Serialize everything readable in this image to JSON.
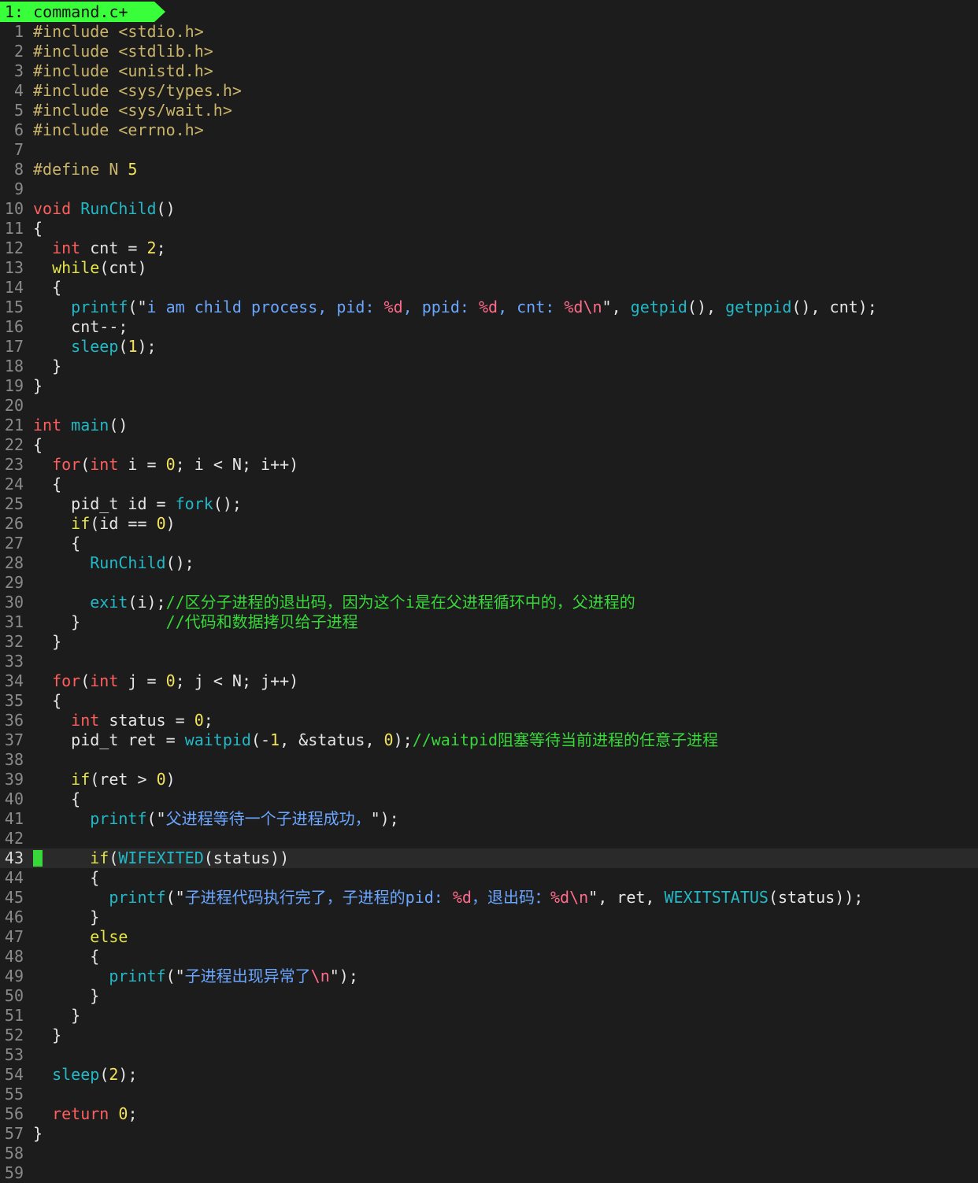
{
  "tab": {
    "label": "1: command.c+"
  },
  "cursor_line": "43",
  "lines": [
    {
      "n": "1",
      "segs": [
        [
          "p",
          "#include "
        ],
        [
          "p",
          "<stdio.h>"
        ]
      ]
    },
    {
      "n": "2",
      "segs": [
        [
          "p",
          "#include "
        ],
        [
          "p",
          "<stdlib.h>"
        ]
      ]
    },
    {
      "n": "3",
      "segs": [
        [
          "p",
          "#include "
        ],
        [
          "p",
          "<unistd.h>"
        ]
      ]
    },
    {
      "n": "4",
      "segs": [
        [
          "p",
          "#include "
        ],
        [
          "p",
          "<sys/types.h>"
        ]
      ]
    },
    {
      "n": "5",
      "segs": [
        [
          "p",
          "#include "
        ],
        [
          "p",
          "<sys/wait.h>"
        ]
      ]
    },
    {
      "n": "6",
      "segs": [
        [
          "p",
          "#include "
        ],
        [
          "p",
          "<errno.h>"
        ]
      ]
    },
    {
      "n": "7",
      "segs": []
    },
    {
      "n": "8",
      "segs": [
        [
          "p",
          "#define "
        ],
        [
          "p",
          "N "
        ],
        [
          "n",
          "5"
        ]
      ]
    },
    {
      "n": "9",
      "segs": []
    },
    {
      "n": "10",
      "segs": [
        [
          "k",
          "void "
        ],
        [
          "f",
          "RunChild"
        ],
        [
          "",
          "()"
        ]
      ]
    },
    {
      "n": "11",
      "segs": [
        [
          "",
          "{"
        ]
      ]
    },
    {
      "n": "12",
      "segs": [
        [
          "",
          "  "
        ],
        [
          "k",
          "int"
        ],
        [
          "",
          " cnt = "
        ],
        [
          "n",
          "2"
        ],
        [
          "",
          ";"
        ]
      ]
    },
    {
      "n": "13",
      "segs": [
        [
          "",
          "  "
        ],
        [
          "y",
          "while"
        ],
        [
          "",
          "(cnt)"
        ]
      ]
    },
    {
      "n": "14",
      "segs": [
        [
          "",
          "  {"
        ]
      ]
    },
    {
      "n": "15",
      "segs": [
        [
          "",
          "    "
        ],
        [
          "f",
          "printf"
        ],
        [
          "",
          "(\""
        ],
        [
          "s",
          "i am child process, pid: "
        ],
        [
          "e",
          "%d"
        ],
        [
          "s",
          ", ppid: "
        ],
        [
          "e",
          "%d"
        ],
        [
          "s",
          ", cnt: "
        ],
        [
          "e",
          "%d\\n"
        ],
        [
          "",
          "\", "
        ],
        [
          "f",
          "getpid"
        ],
        [
          "",
          "(), "
        ],
        [
          "f",
          "getppid"
        ],
        [
          "",
          "(), cnt);"
        ]
      ]
    },
    {
      "n": "16",
      "segs": [
        [
          "",
          "    cnt--;"
        ]
      ]
    },
    {
      "n": "17",
      "segs": [
        [
          "",
          "    "
        ],
        [
          "f",
          "sleep"
        ],
        [
          "",
          "("
        ],
        [
          "n",
          "1"
        ],
        [
          "",
          ");"
        ]
      ]
    },
    {
      "n": "18",
      "segs": [
        [
          "",
          "  }"
        ]
      ]
    },
    {
      "n": "19",
      "segs": [
        [
          "",
          "}"
        ]
      ]
    },
    {
      "n": "20",
      "segs": []
    },
    {
      "n": "21",
      "segs": [
        [
          "k",
          "int "
        ],
        [
          "f",
          "main"
        ],
        [
          "",
          "()"
        ]
      ]
    },
    {
      "n": "22",
      "segs": [
        [
          "",
          "{"
        ]
      ]
    },
    {
      "n": "23",
      "segs": [
        [
          "",
          "  "
        ],
        [
          "k",
          "for"
        ],
        [
          "",
          "("
        ],
        [
          "k",
          "int"
        ],
        [
          "",
          " i = "
        ],
        [
          "n",
          "0"
        ],
        [
          "",
          "; i < N; i++)"
        ]
      ]
    },
    {
      "n": "24",
      "segs": [
        [
          "",
          "  {"
        ]
      ]
    },
    {
      "n": "25",
      "segs": [
        [
          "",
          "    pid_t id = "
        ],
        [
          "f",
          "fork"
        ],
        [
          "",
          "();"
        ]
      ]
    },
    {
      "n": "26",
      "segs": [
        [
          "",
          "    "
        ],
        [
          "y",
          "if"
        ],
        [
          "",
          "(id == "
        ],
        [
          "n",
          "0"
        ],
        [
          "",
          ")"
        ]
      ]
    },
    {
      "n": "27",
      "segs": [
        [
          "",
          "    {"
        ]
      ]
    },
    {
      "n": "28",
      "segs": [
        [
          "",
          "      "
        ],
        [
          "f",
          "RunChild"
        ],
        [
          "",
          "();"
        ]
      ]
    },
    {
      "n": "29",
      "segs": []
    },
    {
      "n": "30",
      "segs": [
        [
          "",
          "      "
        ],
        [
          "f",
          "exit"
        ],
        [
          "",
          "(i);"
        ],
        [
          "c",
          "//区分子进程的退出码，因为这个i是在父进程循环中的，父进程的"
        ]
      ]
    },
    {
      "n": "31",
      "segs": [
        [
          "",
          "    }         "
        ],
        [
          "c",
          "//代码和数据拷贝给子进程"
        ]
      ]
    },
    {
      "n": "32",
      "segs": [
        [
          "",
          "  }"
        ]
      ]
    },
    {
      "n": "33",
      "segs": []
    },
    {
      "n": "34",
      "segs": [
        [
          "",
          "  "
        ],
        [
          "k",
          "for"
        ],
        [
          "",
          "("
        ],
        [
          "k",
          "int"
        ],
        [
          "",
          " j = "
        ],
        [
          "n",
          "0"
        ],
        [
          "",
          "; j < N; j++)"
        ]
      ]
    },
    {
      "n": "35",
      "segs": [
        [
          "",
          "  {"
        ]
      ]
    },
    {
      "n": "36",
      "segs": [
        [
          "",
          "    "
        ],
        [
          "k",
          "int"
        ],
        [
          "",
          " status = "
        ],
        [
          "n",
          "0"
        ],
        [
          "",
          ";"
        ]
      ]
    },
    {
      "n": "37",
      "segs": [
        [
          "",
          "    pid_t ret = "
        ],
        [
          "f",
          "waitpid"
        ],
        [
          "",
          "(-"
        ],
        [
          "n",
          "1"
        ],
        [
          "",
          ", &status, "
        ],
        [
          "n",
          "0"
        ],
        [
          "",
          ");"
        ],
        [
          "c",
          "//waitpid阻塞等待当前进程的任意子进程"
        ]
      ]
    },
    {
      "n": "38",
      "segs": []
    },
    {
      "n": "39",
      "segs": [
        [
          "",
          "    "
        ],
        [
          "y",
          "if"
        ],
        [
          "",
          "(ret > "
        ],
        [
          "n",
          "0"
        ],
        [
          "",
          ")"
        ]
      ]
    },
    {
      "n": "40",
      "segs": [
        [
          "",
          "    {"
        ]
      ]
    },
    {
      "n": "41",
      "segs": [
        [
          "",
          "      "
        ],
        [
          "f",
          "printf"
        ],
        [
          "",
          "(\""
        ],
        [
          "s",
          "父进程等待一个子进程成功，"
        ],
        [
          "",
          "\");"
        ]
      ]
    },
    {
      "n": "42",
      "segs": []
    },
    {
      "n": "43",
      "segs": [
        [
          "",
          "      "
        ],
        [
          "y",
          "if"
        ],
        [
          "",
          "("
        ],
        [
          "f",
          "WIFEXITED"
        ],
        [
          "",
          "(status))"
        ]
      ]
    },
    {
      "n": "44",
      "segs": [
        [
          "",
          "      {"
        ]
      ]
    },
    {
      "n": "45",
      "segs": [
        [
          "",
          "        "
        ],
        [
          "f",
          "printf"
        ],
        [
          "",
          "(\""
        ],
        [
          "s",
          "子进程代码执行完了，子进程的pid: "
        ],
        [
          "e",
          "%d"
        ],
        [
          "s",
          "，退出码："
        ],
        [
          "e",
          "%d\\n"
        ],
        [
          "",
          "\", ret, "
        ],
        [
          "f",
          "WEXITSTATUS"
        ],
        [
          "",
          "(status));"
        ]
      ]
    },
    {
      "n": "46",
      "segs": [
        [
          "",
          "      }"
        ]
      ]
    },
    {
      "n": "47",
      "segs": [
        [
          "",
          "      "
        ],
        [
          "y",
          "else"
        ]
      ]
    },
    {
      "n": "48",
      "segs": [
        [
          "",
          "      {"
        ]
      ]
    },
    {
      "n": "49",
      "segs": [
        [
          "",
          "        "
        ],
        [
          "f",
          "printf"
        ],
        [
          "",
          "(\""
        ],
        [
          "s",
          "子进程出现异常了"
        ],
        [
          "e",
          "\\n"
        ],
        [
          "",
          "\");"
        ]
      ]
    },
    {
      "n": "50",
      "segs": [
        [
          "",
          "      }"
        ]
      ]
    },
    {
      "n": "51",
      "segs": [
        [
          "",
          "    }"
        ]
      ]
    },
    {
      "n": "52",
      "segs": [
        [
          "",
          "  }"
        ]
      ]
    },
    {
      "n": "53",
      "segs": []
    },
    {
      "n": "54",
      "segs": [
        [
          "",
          "  "
        ],
        [
          "f",
          "sleep"
        ],
        [
          "",
          "("
        ],
        [
          "n",
          "2"
        ],
        [
          "",
          ");"
        ]
      ]
    },
    {
      "n": "55",
      "segs": []
    },
    {
      "n": "56",
      "segs": [
        [
          "",
          "  "
        ],
        [
          "k",
          "return "
        ],
        [
          "n",
          "0"
        ],
        [
          "",
          ";"
        ]
      ]
    },
    {
      "n": "57",
      "segs": [
        [
          "",
          "}"
        ]
      ]
    },
    {
      "n": "58",
      "segs": []
    },
    {
      "n": "59",
      "segs": []
    }
  ]
}
